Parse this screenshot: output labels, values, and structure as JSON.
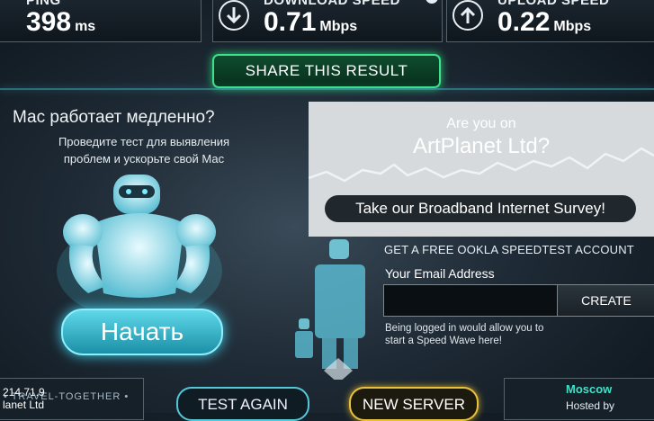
{
  "stats": {
    "ping": {
      "label": "PING",
      "value": "398",
      "unit": "ms"
    },
    "download": {
      "label": "DOWNLOAD SPEED",
      "value": "0.71",
      "unit": "Mbps",
      "info": "i"
    },
    "upload": {
      "label": "UPLOAD SPEED",
      "value": "0.22",
      "unit": "Mbps"
    }
  },
  "share_label": "SHARE THIS RESULT",
  "mac_ad": {
    "title": "Мас работает медленно?",
    "subtitle_line1": "Проведите тест для выявления",
    "subtitle_line2": "проблем и ускорьте свой Мас",
    "start_label": "Начать"
  },
  "survey": {
    "question_line1": "Are you on",
    "question_line2": "ArtPlanet Ltd?",
    "button_label": "Take our Broadband Internet Survey!"
  },
  "account": {
    "title": "GET A FREE OOKLA SPEEDTEST ACCOUNT",
    "email_label": "Your Email Address",
    "email_value": "",
    "create_label": "CREATE",
    "note_line1": "Being logged in would allow you to",
    "note_line2": "start a Speed Wave here!"
  },
  "bottom": {
    "test_again_label": "TEST AGAIN",
    "new_server_label": "NEW SERVER",
    "ip_fragment": "214.71.9",
    "isp_fragment": "lanet Ltd",
    "server_city": "Moscow",
    "hosted_by": "Hosted by"
  },
  "watermark": "• TRAVEL-TOGETHER •",
  "colors": {
    "accent_green": "#3fe28a",
    "accent_cyan": "#55c8d8",
    "accent_yellow": "#e8c23a"
  }
}
